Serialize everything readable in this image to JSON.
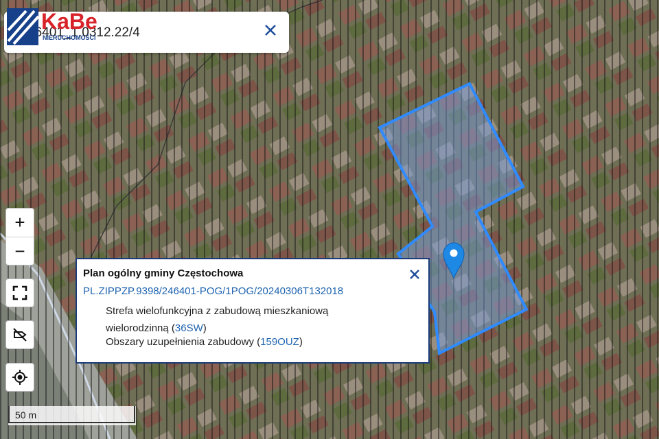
{
  "search": {
    "value": "46401_1.0312.22/4",
    "clear_icon": "close-icon"
  },
  "logo": {
    "brand": "KaBe",
    "tagline": "NIERUCHOMOŚCI",
    "accent": "#d8232a",
    "mark_color": "#16408a"
  },
  "map": {
    "parcel_outline_color": "#2f8bff",
    "marker_color": "#1e88e5",
    "hatch_color": "#111111"
  },
  "controls": {
    "zoom_in": "+",
    "zoom_out": "−",
    "fullscreen_icon": "fullscreen-icon",
    "layers_off_icon": "label-off-icon",
    "locate_icon": "locate-icon"
  },
  "popup": {
    "title": "Plan ogólny gminy Częstochowa",
    "link": "PL.ZIPPZP.9398/246401-POG/1POG/20240306T132018",
    "zone1_text": "Strefa wielofunkcyjna z zabudową mieszkaniową wielorodzinną",
    "zone1_code": "36SW",
    "zone2_text": "Obszary uzupełnienia zabudowy",
    "zone2_code": "159OUZ",
    "close_icon": "close-icon"
  },
  "scale": {
    "label": "50 m"
  }
}
